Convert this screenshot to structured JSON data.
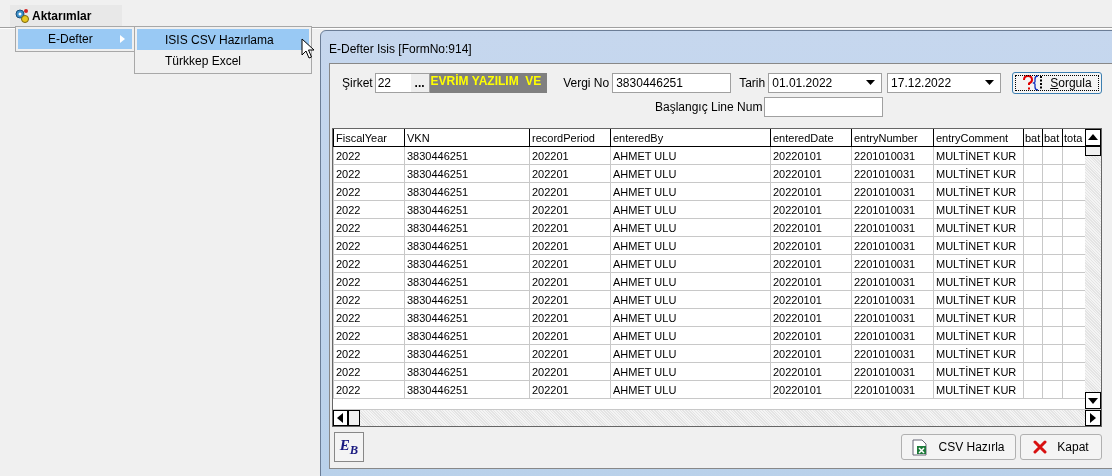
{
  "menu": {
    "label": "Aktarımlar",
    "items": [
      {
        "label": "E-Defter",
        "selected": true,
        "submenu": [
          {
            "label": "ISIS CSV Hazırlama",
            "selected": true
          },
          {
            "label": "Türkkep Excel",
            "selected": false
          }
        ]
      }
    ]
  },
  "window": {
    "title": "E-Defter Isis [FormNo:914]"
  },
  "form": {
    "company_label": "Şirket",
    "company_code": "22",
    "browse_button": "...",
    "company_name": "EVRİM YAZILIM  VE",
    "tax_label": "Vergi No",
    "tax_no": "3830446251",
    "date_label": "Tarih",
    "date_from": "01.01.2022",
    "date_to": "17.12.2022",
    "query_button": "Sorgula",
    "start_line_label": "Başlangıç Line Num"
  },
  "table": {
    "columns": [
      {
        "label": "FiscalYear"
      },
      {
        "label": "VKN"
      },
      {
        "label": "recordPeriod"
      },
      {
        "label": "enteredBy"
      },
      {
        "label": "enteredDate"
      },
      {
        "label": "entryNumber"
      },
      {
        "label": "entryComment"
      },
      {
        "label": "bat"
      },
      {
        "label": "bat"
      },
      {
        "label": "tota"
      }
    ],
    "rows": [
      [
        "2022",
        "3830446251",
        "202201",
        "AHMET ULU",
        "20220101",
        "2201010031",
        "MULTİNET KUR"
      ],
      [
        "2022",
        "3830446251",
        "202201",
        "AHMET ULU",
        "20220101",
        "2201010031",
        "MULTİNET KUR"
      ],
      [
        "2022",
        "3830446251",
        "202201",
        "AHMET ULU",
        "20220101",
        "2201010031",
        "MULTİNET KUR"
      ],
      [
        "2022",
        "3830446251",
        "202201",
        "AHMET ULU",
        "20220101",
        "2201010031",
        "MULTİNET KUR"
      ],
      [
        "2022",
        "3830446251",
        "202201",
        "AHMET ULU",
        "20220101",
        "2201010031",
        "MULTİNET KUR"
      ],
      [
        "2022",
        "3830446251",
        "202201",
        "AHMET ULU",
        "20220101",
        "2201010031",
        "MULTİNET KUR"
      ],
      [
        "2022",
        "3830446251",
        "202201",
        "AHMET ULU",
        "20220101",
        "2201010031",
        "MULTİNET KUR"
      ],
      [
        "2022",
        "3830446251",
        "202201",
        "AHMET ULU",
        "20220101",
        "2201010031",
        "MULTİNET KUR"
      ],
      [
        "2022",
        "3830446251",
        "202201",
        "AHMET ULU",
        "20220101",
        "2201010031",
        "MULTİNET KUR"
      ],
      [
        "2022",
        "3830446251",
        "202201",
        "AHMET ULU",
        "20220101",
        "2201010031",
        "MULTİNET KUR"
      ],
      [
        "2022",
        "3830446251",
        "202201",
        "AHMET ULU",
        "20220101",
        "2201010031",
        "MULTİNET KUR"
      ],
      [
        "2022",
        "3830446251",
        "202201",
        "AHMET ULU",
        "20220101",
        "2201010031",
        "MULTİNET KUR"
      ],
      [
        "2022",
        "3830446251",
        "202201",
        "AHMET ULU",
        "20220101",
        "2201010031",
        "MULTİNET KUR"
      ],
      [
        "2022",
        "3830446251",
        "202201",
        "AHMET ULU",
        "20220101",
        "2201010031",
        "MULTİNET KUR"
      ]
    ]
  },
  "logo_button": "E$_{B}$",
  "buttons": [
    {
      "kind": "csv",
      "label": "CSV Hazırla"
    },
    {
      "kind": "close",
      "label": "Kapat"
    }
  ]
}
